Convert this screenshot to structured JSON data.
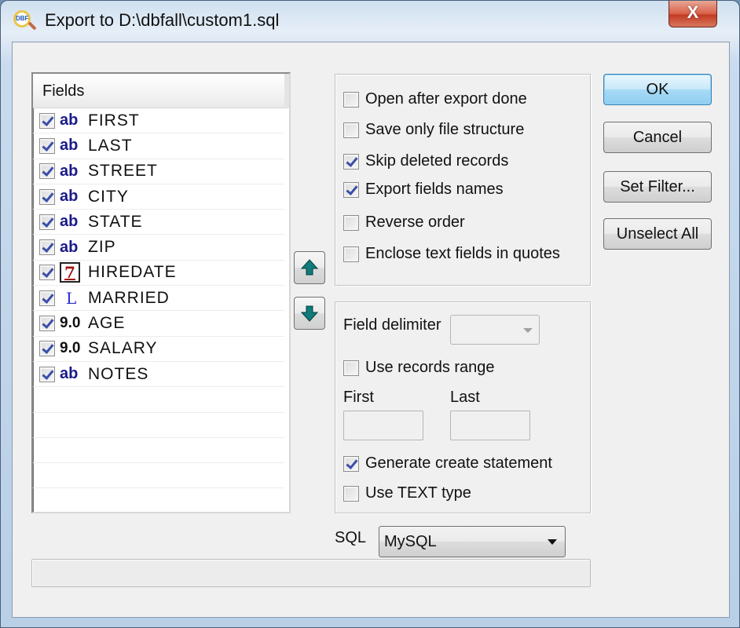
{
  "window": {
    "title": "Export to D:\\dbfall\\custom1.sql",
    "app_icon_text": "DBF",
    "close_glyph": "X"
  },
  "fields_list": {
    "header": "Fields",
    "items": [
      {
        "name": "FIRST",
        "type": "ab",
        "type_kind": "text",
        "checked": true
      },
      {
        "name": "LAST",
        "type": "ab",
        "type_kind": "text",
        "checked": true
      },
      {
        "name": "STREET",
        "type": "ab",
        "type_kind": "text",
        "checked": true
      },
      {
        "name": "CITY",
        "type": "ab",
        "type_kind": "text",
        "checked": true
      },
      {
        "name": "STATE",
        "type": "ab",
        "type_kind": "text",
        "checked": true
      },
      {
        "name": "ZIP",
        "type": "ab",
        "type_kind": "text",
        "checked": true
      },
      {
        "name": "HIREDATE",
        "type": "7",
        "type_kind": "date",
        "checked": true
      },
      {
        "name": "MARRIED",
        "type": "L",
        "type_kind": "logical",
        "checked": true
      },
      {
        "name": "AGE",
        "type": "9.0",
        "type_kind": "numeric",
        "checked": true
      },
      {
        "name": "SALARY",
        "type": "9.0",
        "type_kind": "numeric",
        "checked": true
      },
      {
        "name": "NOTES",
        "type": "ab",
        "type_kind": "text",
        "checked": true
      }
    ]
  },
  "options": [
    {
      "label": "Open after export done",
      "checked": false
    },
    {
      "label": "Save only file structure",
      "checked": false
    },
    {
      "label": "Skip deleted records",
      "checked": true
    },
    {
      "label": "Export fields names",
      "checked": true
    },
    {
      "label": "Reverse order",
      "checked": false
    },
    {
      "label": "Enclose text fields in quotes",
      "checked": false
    }
  ],
  "delimiter": {
    "label": "Field delimiter",
    "value": ""
  },
  "range": {
    "use_label": "Use records range",
    "use_checked": false,
    "first_label": "First",
    "first_value": "",
    "last_label": "Last",
    "last_value": ""
  },
  "create_options": [
    {
      "label": "Generate create statement",
      "checked": true
    },
    {
      "label": "Use TEXT type",
      "checked": false
    }
  ],
  "sql": {
    "label": "SQL",
    "value": "MySQL"
  },
  "buttons": {
    "ok": "OK",
    "cancel": "Cancel",
    "set_filter": "Set Filter...",
    "unselect_all": "Unselect All"
  },
  "progress": 0
}
